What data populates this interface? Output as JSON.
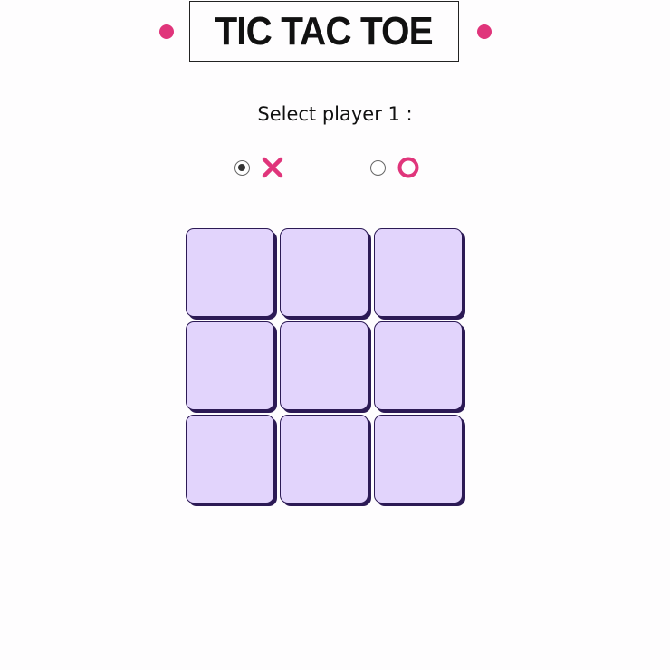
{
  "header": {
    "title": "TIC TAC TOE"
  },
  "player_select": {
    "prompt": "Select player 1 :",
    "options": [
      {
        "symbol": "X",
        "icon": "x-icon",
        "selected": true
      },
      {
        "symbol": "O",
        "icon": "o-icon",
        "selected": false
      }
    ]
  },
  "board": {
    "cells": [
      "",
      "",
      "",
      "",
      "",
      "",
      "",
      "",
      ""
    ]
  },
  "colors": {
    "accent": "#e0357b",
    "cell_fill": "#e2d4fc",
    "cell_border": "#2c1a55"
  }
}
